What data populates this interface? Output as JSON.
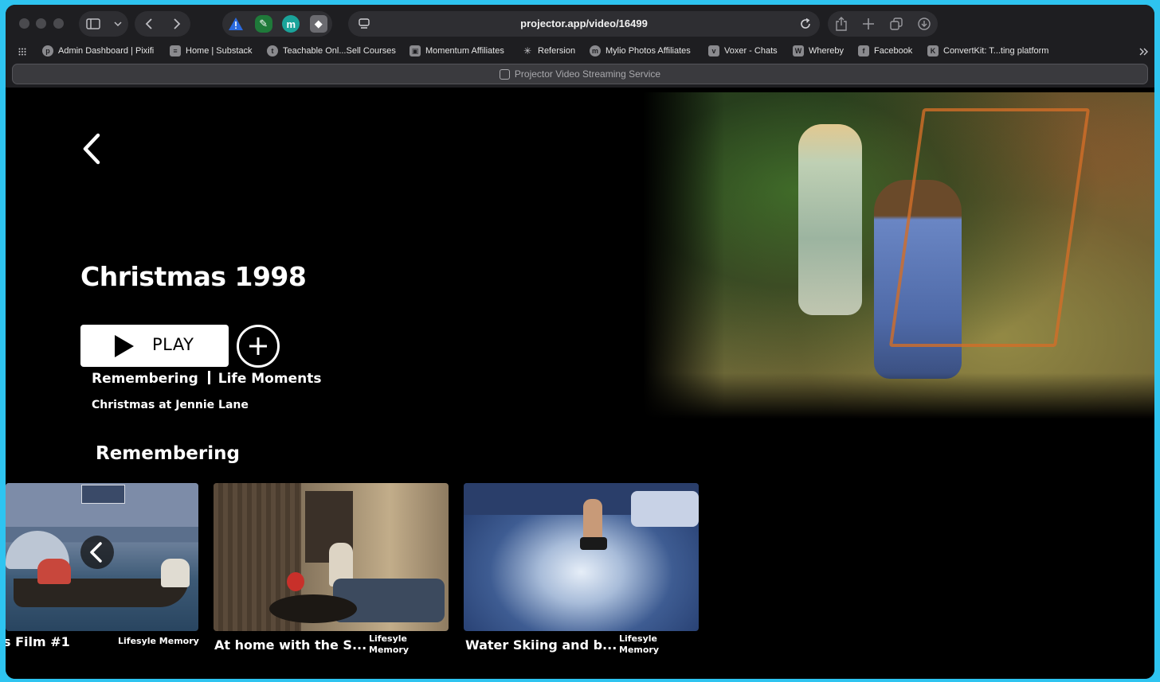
{
  "browser": {
    "url": "projector.app/video/16499",
    "tab_title": "Projector Video Streaming Service",
    "extensions": [
      "warning-extension",
      "evernote-extension",
      "m-extension",
      "shield-extension"
    ],
    "bookmarks": [
      {
        "label": "Admin Dashboard | Pixifi",
        "icon": "pixifi-icon"
      },
      {
        "label": "Home | Substack",
        "icon": "substack-icon"
      },
      {
        "label": "Teachable Onl...Sell Courses",
        "icon": "teachable-icon"
      },
      {
        "label": "Momentum Affiliates",
        "icon": "momentum-icon"
      },
      {
        "label": "Refersion",
        "icon": "refersion-icon"
      },
      {
        "label": "Mylio Photos Affiliates",
        "icon": "mylio-icon"
      },
      {
        "label": "Voxer - Chats",
        "icon": "voxer-icon"
      },
      {
        "label": "Whereby",
        "icon": "whereby-icon"
      },
      {
        "label": "Facebook",
        "icon": "facebook-icon"
      },
      {
        "label": "ConvertKit: T...ting platform",
        "icon": "convertkit-icon"
      }
    ]
  },
  "video": {
    "title": "Christmas 1998",
    "play_label": "PLAY",
    "category_1": "Remembering",
    "category_2": "Life Moments",
    "subtitle": "Christmas at Jennie Lane"
  },
  "row": {
    "title": "Remembering",
    "items": [
      {
        "title": "s Film #1",
        "tag": "Lifesyle Memory"
      },
      {
        "title": "At home with the S...",
        "tag_line1": "Lifesyle",
        "tag_line2": "Memory"
      },
      {
        "title": "Water Skiing and b...",
        "tag_line1": "Lifesyle",
        "tag_line2": "Memory"
      }
    ]
  },
  "colors": {
    "frame": "#2ec4f0",
    "chrome": "#1e1e21",
    "background": "#000000",
    "text": "#ffffff"
  }
}
